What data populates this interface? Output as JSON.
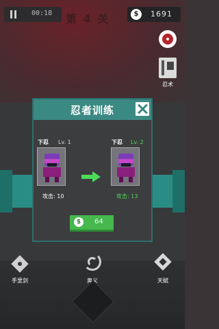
{
  "hud": {
    "timer": "00:18",
    "coins": "1691",
    "coin_symbol": "$",
    "stage": "第 4 关"
  },
  "side": {
    "book_label": "忍术"
  },
  "dialog": {
    "title": "忍者训练",
    "current": {
      "name": "下忍",
      "level": "Lv. 1",
      "attack": "攻击: 10"
    },
    "next": {
      "name": "下忍",
      "level": "Lv. 2",
      "attack": "攻击: 13"
    },
    "upgrade_cost": "64",
    "upgrade_symbol": "$"
  },
  "menu": {
    "items": [
      {
        "label": "手里剑",
        "icon": "shuriken-icon"
      },
      {
        "label": "奥义",
        "icon": "swirl-icon"
      },
      {
        "label": "天赋",
        "icon": "talent-star-icon"
      }
    ]
  },
  "colors": {
    "teal": "#3b8983",
    "green": "#46b84e",
    "level_up": "#4ddc5a",
    "ninja": "#7a3fb8"
  }
}
